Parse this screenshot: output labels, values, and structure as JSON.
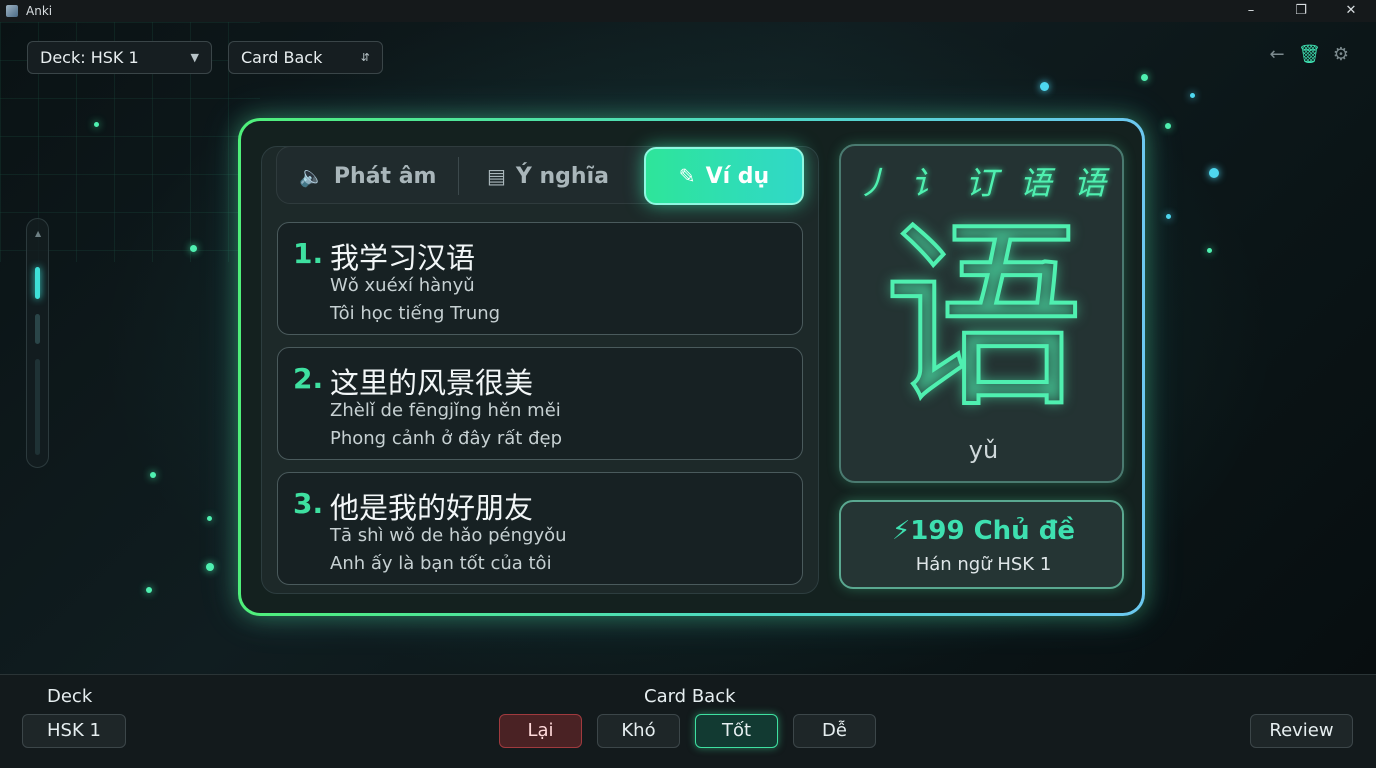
{
  "window": {
    "title": "Anki",
    "controls": [
      "minimize",
      "restore",
      "close"
    ]
  },
  "toolbar": {
    "deck_select": "Deck: HSK 1",
    "side_select": "Card Back",
    "icons": [
      "back-arrow-icon",
      "trash-icon",
      "gear-icon"
    ]
  },
  "tabs": [
    {
      "label": "Phát âm",
      "icon": "speaker-icon",
      "active": false
    },
    {
      "label": "Ý nghĩa",
      "icon": "note-icon",
      "active": false
    },
    {
      "label": "Ví dụ",
      "icon": "edit-icon",
      "active": true
    }
  ],
  "examples": [
    {
      "num": "1.",
      "hanzi": "我学习汉语",
      "pinyin": "Wǒ xuéxí hànyǔ",
      "meaning": "Tôi học tiếng Trung"
    },
    {
      "num": "2.",
      "hanzi": "这里的风景很美",
      "pinyin": "Zhèlǐ de fēngjǐng hěn měi",
      "meaning": "Phong cảnh ở đây rất đẹp"
    },
    {
      "num": "3.",
      "hanzi": "他是我的好朋友",
      "pinyin": "Tā shì wǒ de hǎo péngyǒu",
      "meaning": "Anh ấy là bạn tốt của tôi"
    }
  ],
  "character": {
    "stroke_sequence": "丿 讠 订 语 语",
    "hanzi": "语",
    "pinyin": "yǔ"
  },
  "topic": {
    "title": "199 Chủ đề",
    "subtitle": "Hán ngữ HSK 1",
    "icon": "bolt-icon"
  },
  "bottom": {
    "deck_label": "Deck",
    "deck_button": "HSK 1",
    "side_label": "Card Back",
    "answers": [
      {
        "label": "Lại",
        "kind": "again"
      },
      {
        "label": "Khó",
        "kind": "hard"
      },
      {
        "label": "Tốt",
        "kind": "good"
      },
      {
        "label": "Dễ",
        "kind": "easy"
      }
    ],
    "review_button": "Review"
  },
  "colors": {
    "accent_green": "#3ee0a0",
    "accent_cyan": "#4fd8f0",
    "again_red": "#a03a3e"
  }
}
